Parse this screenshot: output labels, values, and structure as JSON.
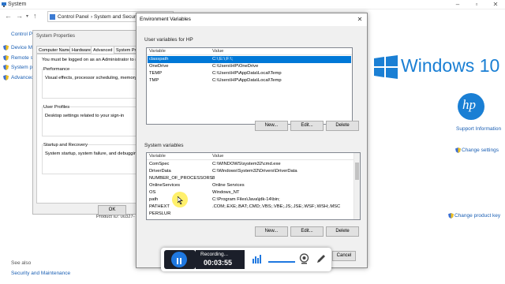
{
  "system_window": {
    "title": "System",
    "breadcrumb": [
      "Control Panel",
      "System and Security"
    ],
    "left_nav": [
      "Control Pa",
      "Device Ma",
      "Remote se",
      "System pro",
      "Advanced"
    ],
    "see_also": "See also",
    "security_maintenance": "Security and Maintenance",
    "windows_logo_text": "Windows 10",
    "hp_logo_text": "hp",
    "support_info": "Support Information",
    "change_settings": "Change settings",
    "change_product_key": "Change product key",
    "product_id_label": "Product ID: 00327-"
  },
  "system_properties": {
    "title": "System Properties",
    "tabs": [
      "Computer Name",
      "Hardware",
      "Advanced",
      "System Prot"
    ],
    "admin_note": "You must be logged on as an Administrator to make m",
    "performance_title": "Performance",
    "performance_text": "Visual effects, processor scheduling, memory usa",
    "profiles_title": "User Profiles",
    "profiles_text": "Desktop settings related to your sign-in",
    "startup_title": "Startup and Recovery",
    "startup_text": "System startup, system failure, and debugging infr",
    "ok_label": "OK"
  },
  "env_dialog": {
    "title": "Environment Variables",
    "close_glyph": "✕",
    "user_section": "User variables for HP",
    "system_section": "System variables",
    "col_variable": "Variable",
    "col_value": "Value",
    "user_vars": [
      {
        "variable": "classpath",
        "value": "C:\\;E:\\;F:\\;"
      },
      {
        "variable": "OneDrive",
        "value": "C:\\Users\\HP\\OneDrive"
      },
      {
        "variable": "TEMP",
        "value": "C:\\Users\\HP\\AppData\\Local\\Temp"
      },
      {
        "variable": "TMP",
        "value": "C:\\Users\\HP\\AppData\\Local\\Temp"
      }
    ],
    "system_vars": [
      {
        "variable": "ComSpec",
        "value": "C:\\WINDOWS\\system32\\cmd.exe"
      },
      {
        "variable": "DriverData",
        "value": "C:\\Windows\\System32\\Drivers\\DriverData"
      },
      {
        "variable": "NUMBER_OF_PROCESSORS",
        "value": "8"
      },
      {
        "variable": "OnlineServices",
        "value": "Online Services"
      },
      {
        "variable": "OS",
        "value": "Windows_NT"
      },
      {
        "variable": "path",
        "value": "C:\\Program Files\\Java\\jdk-14\\bin;"
      },
      {
        "variable": "PATHEXT",
        "value": ".COM;.EXE;.BAT;.CMD;.VBS;.VBE;.JS;.JSE;.WSF;.WSH;.MSC"
      },
      {
        "variable": "PERSLUR",
        "value": ""
      }
    ],
    "new_label": "New...",
    "edit_label": "Edit...",
    "delete_label": "Delete",
    "cancel_label": "Cancel"
  },
  "recorder": {
    "status": "Recording...",
    "time": "00:03:55"
  },
  "colors": {
    "selection": "#0078d7",
    "win_blue": "#1a7fd4",
    "link": "#1a5fb4"
  }
}
